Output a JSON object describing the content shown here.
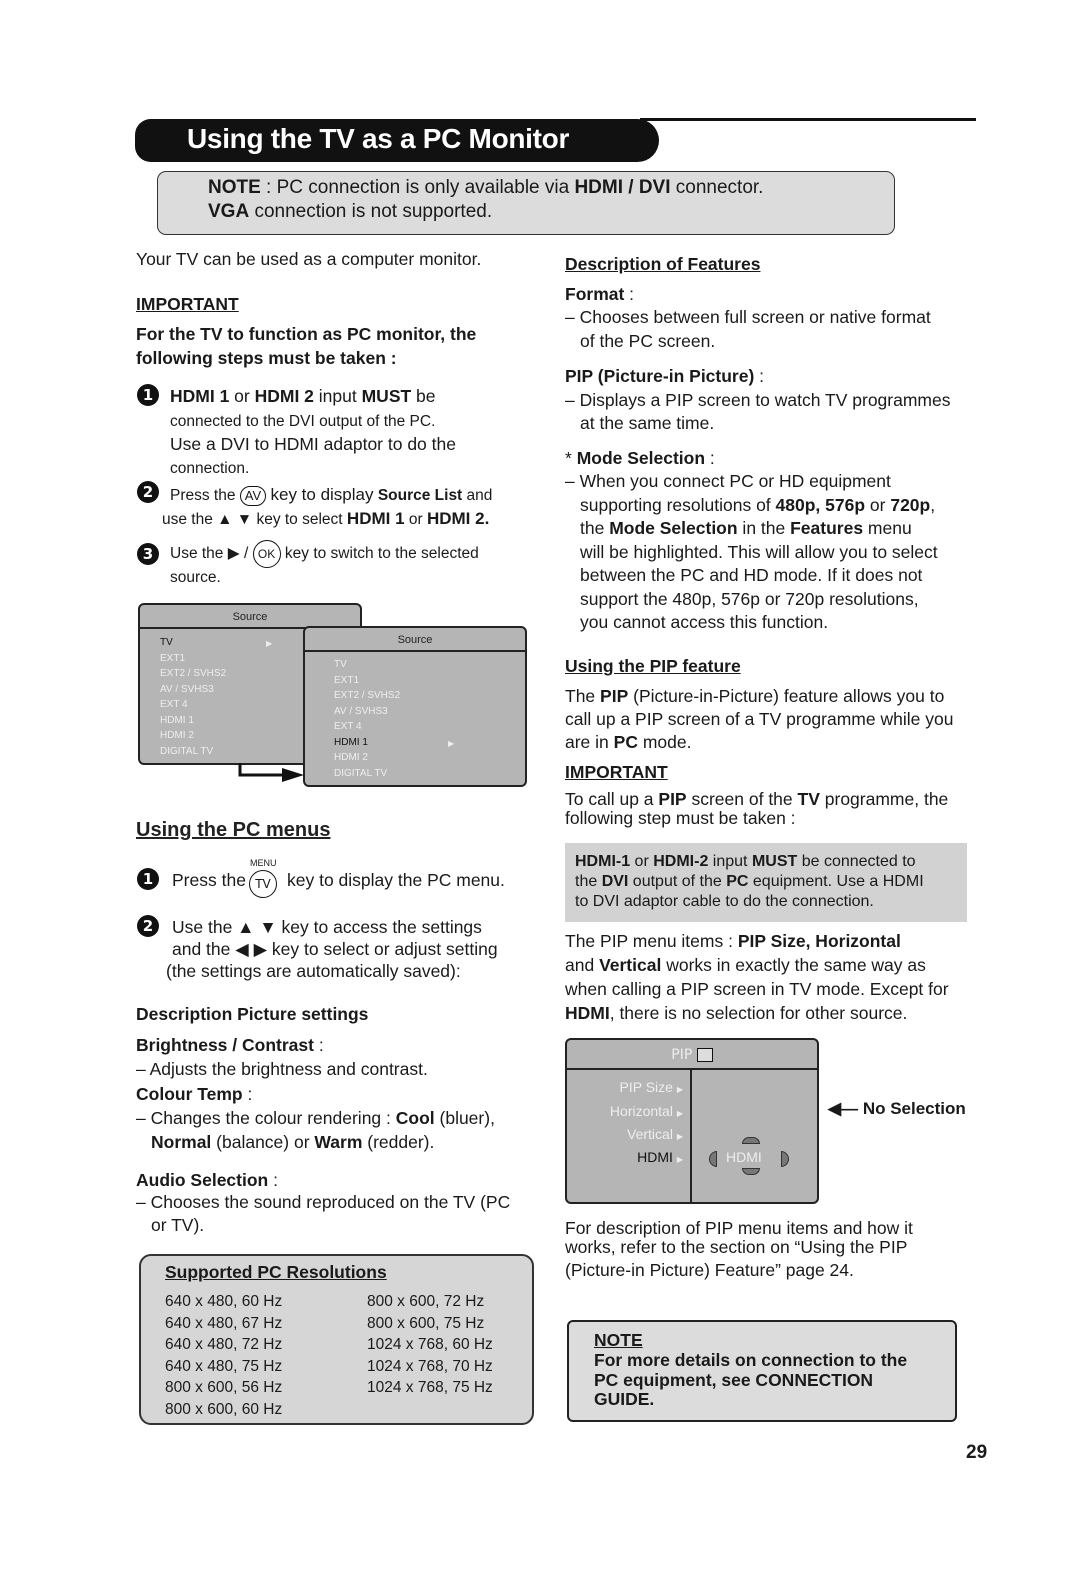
{
  "header": {
    "title": "Using the TV as a PC Monitor",
    "note_line1": {
      "label": "NOTE",
      "pre": " : PC connection is only available via ",
      "bold": "HDMI / DVI",
      "post": " connector."
    },
    "note_line2": {
      "bold": "VGA",
      "post": " connection is not supported."
    }
  },
  "left": {
    "intro": "Your TV can be used as a computer monitor.",
    "important_heading": "IMPORTANT",
    "important_text_1": "For the TV to function as PC monitor, the",
    "important_text_2": "following steps must be taken :",
    "steps": [
      {
        "num": "1",
        "lines": [
          "HDMI 1 or HDMI 2 input MUST be",
          "connected to the DVI output of the PC.",
          "Use a DVI to HDMI adaptor to do the",
          "connection."
        ]
      },
      {
        "num": "2",
        "pre": "Press the",
        "key": "AV",
        "mid": "key to display",
        "bold": "Source List",
        "post": "and",
        "line2_pre": "use the ▲ ▼ key to select",
        "line2_bold1": "HDMI 1",
        "line2_or": "or",
        "line2_bold2": "HDMI 2."
      },
      {
        "num": "3",
        "pre": "Use the ▶ /",
        "key": "OK",
        "post": "key to switch to the selected",
        "line2": "source."
      }
    ],
    "source_menu_back": {
      "title": "Source",
      "items": [
        "TV",
        "EXT1",
        "EXT2 / SVHS2",
        "AV / SVHS3",
        "EXT 4",
        "HDMI 1",
        "HDMI 2",
        "DIGITAL TV"
      ],
      "selected": "TV"
    },
    "source_menu_front": {
      "title": "Source",
      "items": [
        "TV",
        "EXT1",
        "EXT2 / SVHS2",
        "AV / SVHS3",
        "EXT 4",
        "HDMI 1",
        "HDMI 2",
        "DIGITAL TV"
      ],
      "selected": "HDMI 1"
    },
    "pc_menus_heading": "Using the PC menus",
    "pc_steps": [
      {
        "num": "1",
        "pre": "Press the",
        "key_top": "MENU",
        "key": "TV",
        "post": "key to display the PC menu."
      },
      {
        "num": "2",
        "line1": "Use the ▲ ▼ key to access the settings",
        "line2": "and the ◀  ▶ key to select or adjust setting",
        "line3": "(the settings are automatically saved):"
      }
    ],
    "desc_heading": "Description Picture settings",
    "brightness_label": "Brightness / Contrast",
    "brightness_desc": "– Adjusts the brightness and contrast.",
    "colour_label": "Colour Temp",
    "colour_desc_1": {
      "pre": "– Changes the colour rendering : ",
      "cool": "Cool",
      "post": " (bluer),"
    },
    "colour_desc_2": {
      "normal": "Normal",
      "mid": " (balance) or ",
      "warm": "Warm",
      "post": " (redder)."
    },
    "audio_label": "Audio Selection",
    "audio_desc_1": "– Chooses the sound reproduced on the TV (PC",
    "audio_desc_2": "or TV).",
    "resolutions": {
      "heading": "Supported PC Resolutions",
      "col1": [
        "640 x 480, 60 Hz",
        "640 x 480, 67 Hz",
        "640 x 480, 72 Hz",
        "640 x 480, 75 Hz",
        "800 x 600, 56 Hz",
        "800 x 600, 60 Hz"
      ],
      "col2": [
        "800 x 600, 72 Hz",
        "800 x 600, 75 Hz",
        "1024 x 768, 60 Hz",
        "1024 x 768, 70 Hz",
        "1024 x 768, 75 Hz"
      ]
    }
  },
  "right": {
    "features_heading": "Description of Features",
    "format_label": "Format",
    "format_desc_1": "– Chooses between full screen or native format",
    "format_desc_2": "of the PC screen.",
    "pip_label": "PIP (Picture-in Picture)",
    "pip_desc_1": "– Displays a PIP screen to watch TV programmes",
    "pip_desc_2": "at the same time.",
    "mode_label": "Mode Selection",
    "mode_desc": [
      "– When you connect PC or HD equipment",
      "supporting resolutions of 480p, 576p or 720p,",
      "the Mode Selection in the Features menu",
      "will be highlighted. This will allow you to select",
      "between the PC and HD mode. If it does not",
      "support the 480p, 576p or 720p resolutions,",
      "you cannot access this function."
    ],
    "pip_feature_heading": "Using the PIP feature",
    "pip_feature_text": [
      "The PIP (Picture-in-Picture) feature allows you to",
      "call up a PIP screen of a TV programme while you",
      "are in PC mode."
    ],
    "important_heading": "IMPORTANT",
    "important_text": [
      "To call up a PIP screen of the TV programme, the",
      "following step must be taken :"
    ],
    "hdmi_box": [
      "HDMI-1 or HDMI-2 input MUST be connected to",
      "the DVI output of the PC equipment. Use a HDMI",
      "to DVI adaptor cable to do the connection."
    ],
    "pip_items_text": [
      "The PIP menu items : PIP Size, Horizontal",
      "and Vertical works in exactly the same way as",
      "when calling a PIP screen in TV mode. Except for",
      "HDMI, there is no selection for other source."
    ],
    "pip_menu": {
      "title": "PIP",
      "items": [
        "PIP Size",
        "Horizontal",
        "Vertical",
        "HDMI"
      ],
      "selected": "HDMI",
      "value": "HDMI"
    },
    "no_selection": "No Selection",
    "refer_text": [
      "For description of PIP menu items and how it",
      "works, refer to the section on “Using the PIP",
      "(Picture-in Picture) Feature” page 24."
    ],
    "note": {
      "heading": "NOTE",
      "lines": [
        "For more details on connection to the",
        "PC equipment, see CONNECTION",
        "GUIDE."
      ]
    }
  },
  "page_number": "29"
}
